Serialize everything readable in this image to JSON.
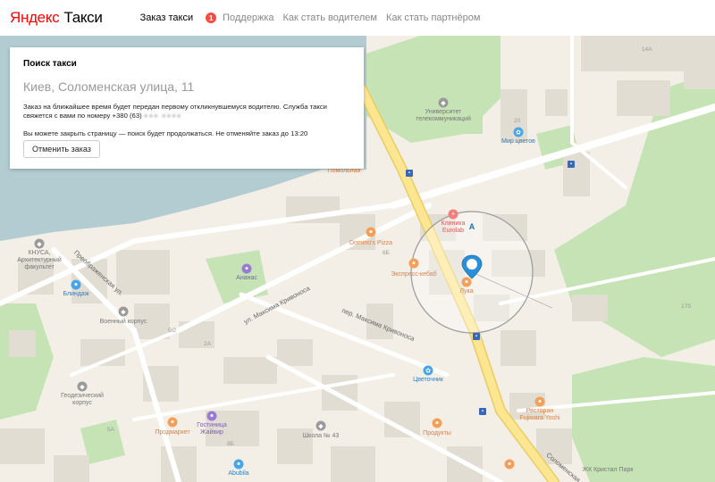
{
  "header": {
    "logo_brand": "Яндекс",
    "logo_product": "Такси",
    "nav": {
      "order": "Заказ такси",
      "order_badge": "1",
      "support": "Поддержка",
      "driver": "Как стать водителем",
      "partner": "Как стать партнёром"
    }
  },
  "panel": {
    "title": "Поиск такси",
    "address": "Киев, Соломенская улица, 11",
    "message_line1": "Заказ на ближайшее время будет передан первому откликнувшемуся водителю. Служба такси",
    "message_line2": "свяжется с вами по номеру +380 (63) ",
    "phone_hidden": "●●● ●●●●",
    "info": "Вы можете закрыть страницу — поиск будет продолжаться. Не отменяйте заказ до 13:20",
    "cancel_label": "Отменить заказ"
  },
  "map": {
    "colors": {
      "background": "#f3efe7",
      "water": "#b3ccd2",
      "park": "#c6e3b6",
      "road_main": "#fde692",
      "road": "#ffffff",
      "building": "#e2ddd3",
      "poi_orange": "#f5a05a",
      "poi_blue": "#4aa5e6",
      "poi_purple": "#9b7ad6",
      "poi_gray": "#9a9a9a",
      "marker": "#2a8fd9"
    },
    "streets": {
      "preobrazhenskaya": "Преображенская ул.",
      "kryvonosa": "ул. Максима Кривоноса",
      "kryvonosa_lane": "пер. Максима Кривоноса",
      "solomenskaya": "Соломенская"
    },
    "places": {
      "pomolnaya": "Помольная",
      "dominos": "Domino's Pizza",
      "kebab": "Экспресс-кебаб",
      "evrolab": "Клиника\nEurolab",
      "luka": "Лука",
      "univ": "Университет\nтелекоммуникаций",
      "mir_cvetov": "Мир цветов",
      "ananas": "Ананас",
      "knusa": "КНУСА,\nАрхитектурный\nфакультет",
      "blindage": "Блиндаж",
      "voen": "Военный корпус",
      "geodez": "Геодезический\nкорпус",
      "prodmarket": "Продмаркет",
      "zhaivir": "Гостиница\nЖайвир",
      "school": "Школа № 43",
      "cvetochnik": "Цветочник",
      "produkty": "Продукты",
      "restoran": "Ресторан\nFujiwara Yoshi",
      "abubila": "Abubila",
      "zhk": "ЖК Кристал Парк"
    },
    "marker_letter": "А",
    "house_numbers": {
      "n14a": "14А",
      "n20": "20",
      "n6b": "6Б",
      "n17b": "17б",
      "n2a": "2А",
      "n5a": "5А",
      "n8": "8Б",
      "n5_2": "5/2"
    }
  }
}
